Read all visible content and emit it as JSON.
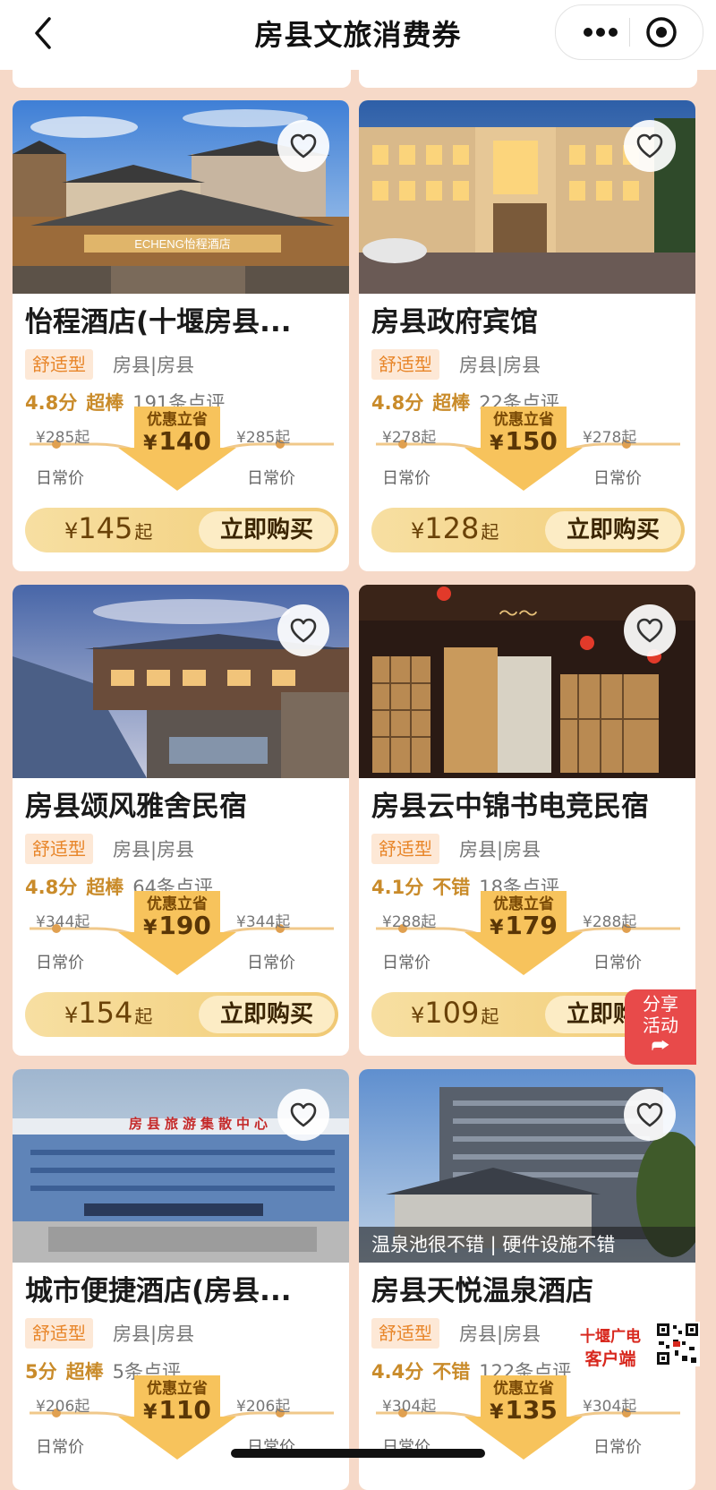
{
  "header": {
    "title": "房县文旅消费券",
    "back_icon": "chevron-left-icon",
    "more_icon": "more-dots-icon",
    "close_icon": "target-circle-icon"
  },
  "colors": {
    "background": "#f6d9c8",
    "accent_orange": "#e8862a",
    "gold": "#f4d487",
    "share_red": "#e84a4a"
  },
  "cards": [
    {
      "name": "怡程酒店(十堰房县...",
      "tag": "舒适型",
      "location": "房县|房县",
      "score": "4.8分",
      "level": "超棒",
      "reviews": "191条点评",
      "left_price": "¥285起",
      "right_price": "¥285起",
      "left_label": "日常价",
      "right_label": "日常价",
      "save_label": "优惠立省",
      "save_yen": "¥",
      "save_amount": "140",
      "buy_yen": "¥",
      "buy_price": "145",
      "buy_suffix": "起",
      "buy_label": "立即购买",
      "photo_sign": "ECHENG怡程酒店",
      "photo": "hotel-photo-echeng"
    },
    {
      "name": "房县政府宾馆",
      "tag": "舒适型",
      "location": "房县|房县",
      "score": "4.8分",
      "level": "超棒",
      "reviews": "22条点评",
      "left_price": "¥278起",
      "right_price": "¥278起",
      "left_label": "日常价",
      "right_label": "日常价",
      "save_label": "优惠立省",
      "save_yen": "¥",
      "save_amount": "150",
      "buy_yen": "¥",
      "buy_price": "128",
      "buy_suffix": "起",
      "buy_label": "立即购买",
      "photo": "hotel-photo-government"
    },
    {
      "name": "房县颂风雅舍民宿",
      "tag": "舒适型",
      "location": "房县|房县",
      "score": "4.8分",
      "level": "超棒",
      "reviews": "64条点评",
      "left_price": "¥344起",
      "right_price": "¥344起",
      "left_label": "日常价",
      "right_label": "日常价",
      "save_label": "优惠立省",
      "save_yen": "¥",
      "save_amount": "190",
      "buy_yen": "¥",
      "buy_price": "154",
      "buy_suffix": "起",
      "buy_label": "立即购买",
      "photo": "homestay-photo-songfeng"
    },
    {
      "name": "房县云中锦书电竞民宿",
      "tag": "舒适型",
      "location": "房县|房县",
      "score": "4.1分",
      "level": "不错",
      "reviews": "18条点评",
      "left_price": "¥288起",
      "right_price": "¥288起",
      "left_label": "日常价",
      "right_label": "日常价",
      "save_label": "优惠立省",
      "save_yen": "¥",
      "save_amount": "179",
      "buy_yen": "¥",
      "buy_price": "109",
      "buy_suffix": "起",
      "buy_label": "立即购买",
      "photo": "homestay-photo-yunzhong"
    },
    {
      "name": "城市便捷酒店(房县...",
      "tag": "舒适型",
      "location": "房县|房县",
      "score": "5分",
      "level": "超棒",
      "reviews": "5条点评",
      "left_price": "¥206起",
      "right_price": "¥206起",
      "left_label": "日常价",
      "right_label": "日常价",
      "save_label": "优惠立省",
      "save_yen": "¥",
      "save_amount": "110",
      "photo_sign": "房县旅游集散中心",
      "photo": "hotel-photo-city-inn"
    },
    {
      "name": "房县天悦温泉酒店",
      "tag": "舒适型",
      "location": "房县|房县",
      "score": "4.4分",
      "level": "不错",
      "reviews": "122条点评",
      "left_price": "¥304起",
      "right_price": "¥304起",
      "left_label": "日常价",
      "right_label": "日常价",
      "save_label": "优惠立省",
      "save_yen": "¥",
      "save_amount": "135",
      "review_snippet": "温泉池很不错 | 硬件设施不错",
      "photo": "hotel-photo-tianyue"
    }
  ],
  "share_float": {
    "line1": "分享",
    "line2": "活动",
    "icon": "share-arrow-icon"
  },
  "watermark": {
    "line1": "十堰广电",
    "line2": "客户端",
    "qr": "qr-code-icon"
  }
}
